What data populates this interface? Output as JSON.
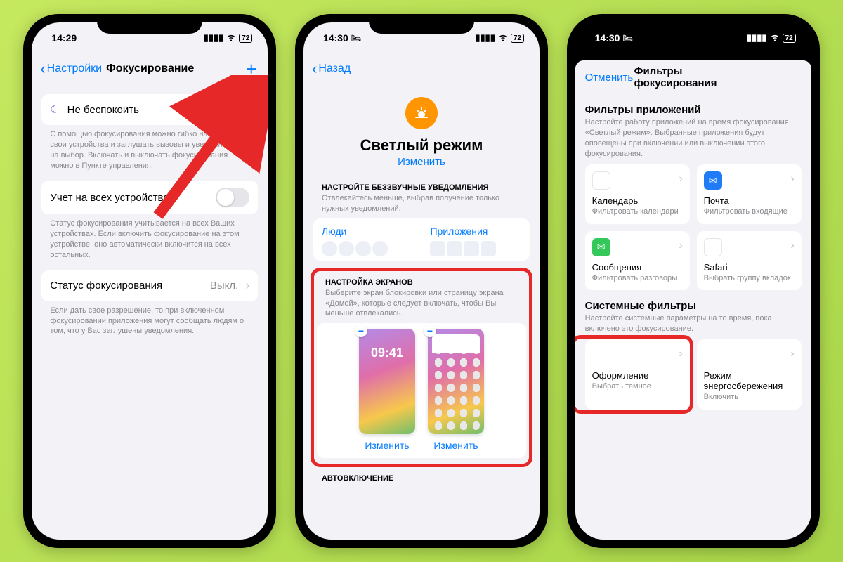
{
  "phone1": {
    "time": "14:29",
    "battery": "72",
    "back_label": "Настройки",
    "title": "Фокусирование",
    "dnd_label": "Не беспокоить",
    "dnd_footer": "С помощью фокусирования можно гибко настраивать свои устройства и заглушать вызовы и уведомления на выбор. Включать и выключать фокусирования можно в Пункте управления.",
    "share_label": "Учет на всех устройствах",
    "share_footer": "Статус фокусирования учитывается на всех Ваших устройствах. Если включить фокусирование на этом устройстве, оно автоматически включится на всех остальных.",
    "status_label": "Статус фокусирования",
    "status_value": "Выкл.",
    "status_footer": "Если дать свое разрешение, то при включенном фокусировании приложения могут сообщать людям о том, что у Вас заглушены уведомления."
  },
  "phone2": {
    "time": "14:30",
    "battery": "72",
    "back_label": "Назад",
    "hero_title": "Светлый режим",
    "hero_action": "Изменить",
    "silence_header": "НАСТРОЙТЕ БЕЗЗВУЧНЫЕ УВЕДОМЛЕНИЯ",
    "silence_sub": "Отвлекайтесь меньше, выбрав получение только нужных уведомлений.",
    "people_label": "Люди",
    "apps_label": "Приложения",
    "screens_header": "НАСТРОЙКА ЭКРАНОВ",
    "screens_sub": "Выберите экран блокировки или страницу экрана «Домой», которые следует включать, чтобы Вы меньше отвлекались.",
    "lock_time": "09:41",
    "edit_label": "Изменить",
    "auto_header": "АВТОВКЛЮЧЕНИЕ"
  },
  "phone3": {
    "time": "14:30",
    "battery": "72",
    "cancel": "Отменить",
    "title": "Фильтры фокусирования",
    "app_filters_header": "Фильтры приложений",
    "app_filters_desc": "Настройте работу приложений на время фокусирования «Светлый режим». Выбранные приложения будут оповещены при включении или выключении этого фокусирования.",
    "cards": {
      "calendar": {
        "title": "Календарь",
        "sub": "Фильтровать календари"
      },
      "mail": {
        "title": "Почта",
        "sub": "Фильтровать входящие"
      },
      "messages": {
        "title": "Сообщения",
        "sub": "Фильтровать разговоры"
      },
      "safari": {
        "title": "Safari",
        "sub": "Выбрать группу вкладок"
      }
    },
    "sys_header": "Системные фильтры",
    "sys_desc": "Настройте системные параметры на то время, пока включено это фокусирование.",
    "appearance": {
      "title": "Оформление",
      "sub": "Выбрать темное"
    },
    "lowpower": {
      "title": "Режим энергосбережения",
      "sub": "Включить"
    }
  }
}
